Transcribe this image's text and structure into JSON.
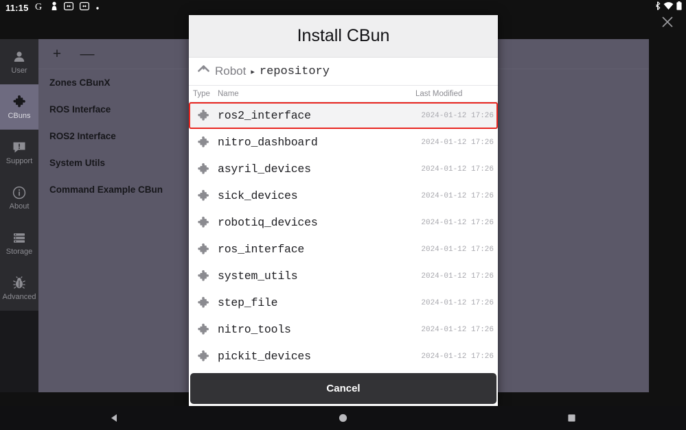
{
  "status_bar": {
    "time": "11:15",
    "left_icons": [
      "google-icon",
      "person-pin-icon",
      "sync-badge-icon",
      "sync-badge-icon",
      "dot-icon"
    ],
    "right_icons": [
      "bluetooth-icon",
      "wifi-icon",
      "battery-icon"
    ]
  },
  "window": {
    "close_label": "✕"
  },
  "sidebar": {
    "items": [
      {
        "label": "User",
        "icon": "user-icon",
        "active": false
      },
      {
        "label": "CBuns",
        "icon": "puzzle-icon",
        "active": true
      },
      {
        "label": "Support",
        "icon": "support-chat-icon",
        "active": false
      },
      {
        "label": "About",
        "icon": "info-icon",
        "active": false
      },
      {
        "label": "Storage",
        "icon": "storage-icon",
        "active": false
      },
      {
        "label": "Advanced",
        "icon": "bug-icon",
        "active": false
      }
    ]
  },
  "cbun_panel": {
    "toolbar": {
      "add_label": "+",
      "remove_label": "—"
    },
    "items": [
      {
        "label": "Zones CBunX"
      },
      {
        "label": "ROS Interface"
      },
      {
        "label": "ROS2 Interface"
      },
      {
        "label": "System Utils"
      },
      {
        "label": "Command Example CBun"
      }
    ]
  },
  "dialog": {
    "title": "Install CBun",
    "breadcrumb": {
      "home_icon": "home-chevron-icon",
      "root": "Robot",
      "separator": "▸",
      "current": "repository"
    },
    "columns": {
      "type": "Type",
      "name": "Name",
      "modified": "Last Modified"
    },
    "files": [
      {
        "name": "ros2_interface",
        "modified": "2024-01-12 17:26",
        "icon": "puzzle-icon",
        "selected": true
      },
      {
        "name": "nitro_dashboard",
        "modified": "2024-01-12 17:26",
        "icon": "puzzle-icon",
        "selected": false
      },
      {
        "name": "asyril_devices",
        "modified": "2024-01-12 17:26",
        "icon": "puzzle-icon",
        "selected": false
      },
      {
        "name": "sick_devices",
        "modified": "2024-01-12 17:26",
        "icon": "puzzle-icon",
        "selected": false
      },
      {
        "name": "robotiq_devices",
        "modified": "2024-01-12 17:26",
        "icon": "puzzle-icon",
        "selected": false
      },
      {
        "name": "ros_interface",
        "modified": "2024-01-12 17:26",
        "icon": "puzzle-icon",
        "selected": false
      },
      {
        "name": "system_utils",
        "modified": "2024-01-12 17:26",
        "icon": "puzzle-icon",
        "selected": false
      },
      {
        "name": "step_file",
        "modified": "2024-01-12 17:26",
        "icon": "puzzle-icon",
        "selected": false
      },
      {
        "name": "nitro_tools",
        "modified": "2024-01-12 17:26",
        "icon": "puzzle-icon",
        "selected": false
      },
      {
        "name": "pickit_devices",
        "modified": "2024-01-12 17:26",
        "icon": "puzzle-icon",
        "selected": false
      }
    ],
    "cancel_label": "Cancel"
  },
  "nav_bar": {
    "back": "back-triangle-icon",
    "home": "home-circle-icon",
    "recents": "recents-square-icon"
  },
  "colors": {
    "highlight": "#e8251f",
    "sidebar_active": "#6e6b80",
    "panel": "#5b5868",
    "dialog_header": "#efeff0",
    "cancel_button": "#333336"
  }
}
